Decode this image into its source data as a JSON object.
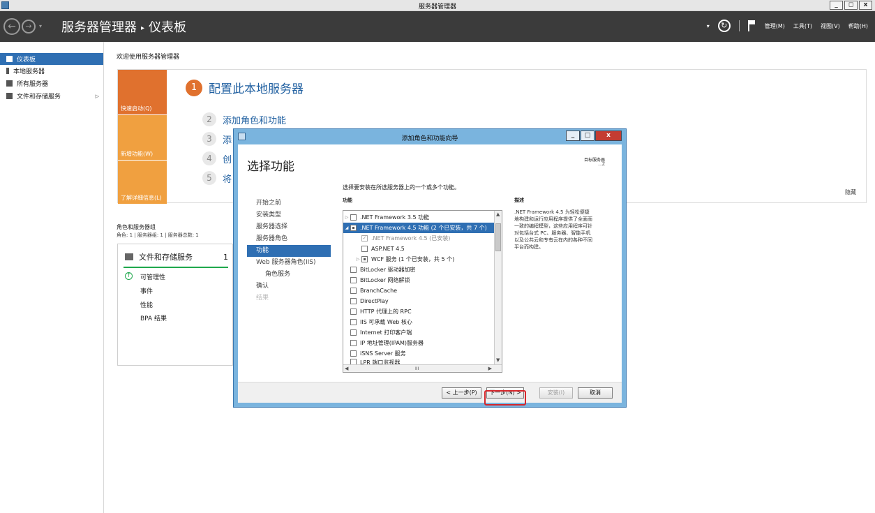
{
  "window": {
    "title": "服务器管理器",
    "controls": [
      "_",
      "◻",
      "x"
    ]
  },
  "header": {
    "crumb_app": "服务器管理器",
    "crumb_sep": "▸",
    "crumb_page": "仪表板",
    "menus": [
      "管理(M)",
      "工具(T)",
      "视图(V)",
      "帮助(H)"
    ]
  },
  "sidebar": {
    "items": [
      {
        "label": "仪表板",
        "icon": "dashboard-icon",
        "active": true
      },
      {
        "label": "本地服务器",
        "icon": "server-icon"
      },
      {
        "label": "所有服务器",
        "icon": "servers-icon"
      },
      {
        "label": "文件和存储服务",
        "icon": "storage-icon",
        "has_children": true
      }
    ]
  },
  "main": {
    "welcome": "欢迎使用服务器管理器",
    "tiles": [
      "快速启动(Q)",
      "新增功能(W)",
      "了解详细信息(L)"
    ],
    "steps": [
      {
        "num": "1",
        "label": "配置此本地服务器"
      },
      {
        "num": "2",
        "label": "添加角色和功能"
      },
      {
        "num": "3",
        "label": "添"
      },
      {
        "num": "4",
        "label": "创"
      },
      {
        "num": "5",
        "label": "将"
      }
    ],
    "hide": "隐藏",
    "roles_title": "角色和服务器组",
    "roles_sub": "角色: 1 | 服务器组: 1 | 服务器总数: 1",
    "role_card": {
      "title": "文件和存储服务",
      "count": "1",
      "rows": [
        "可管理性",
        "事件",
        "性能",
        "BPA 结果"
      ]
    }
  },
  "dialog": {
    "title": "添加角色和功能向导",
    "heading": "选择功能",
    "dest_label": "目标服务器",
    "dest_value": "...Z",
    "nav": [
      {
        "label": "开始之前"
      },
      {
        "label": "安装类型"
      },
      {
        "label": "服务器选择"
      },
      {
        "label": "服务器角色"
      },
      {
        "label": "功能",
        "active": true
      },
      {
        "label": "Web 服务器角色(IIS)"
      },
      {
        "label": "角色服务",
        "sub": true
      },
      {
        "label": "确认"
      },
      {
        "label": "结果",
        "disabled": true
      }
    ],
    "instruction": "选择要安装在所选服务器上的一个或多个功能。",
    "features_header": "功能",
    "description_header": "描述",
    "description": ".NET Framework 4.5 为轻松便捷地构建和运行应用程序提供了全面而一致的编程模型，这些应用程序可针对包括台式 PC、服务器、智能手机以及公共云和专有云在内的各种不同平台而构建。",
    "features": [
      {
        "label": ".NET Framework 3.5 功能",
        "expander": "▷",
        "check": "",
        "indent": 0
      },
      {
        "label": ".NET Framework 4.5 功能 (2 个已安装，共 7 个)",
        "expander": "◢",
        "check": "partial",
        "indent": 0,
        "selected": true
      },
      {
        "label": ".NET Framework 4.5 (已安装)",
        "expander": "",
        "check": "✓",
        "indent": 1,
        "dim": true
      },
      {
        "label": "ASP.NET 4.5",
        "expander": "",
        "check": "",
        "indent": 1
      },
      {
        "label": "WCF 服务 (1 个已安装，共 5 个)",
        "expander": "▷",
        "check": "partial",
        "indent": 1
      },
      {
        "label": "BitLocker 驱动器加密",
        "expander": "",
        "check": "",
        "indent": 0
      },
      {
        "label": "BitLocker 网络解锁",
        "expander": "",
        "check": "",
        "indent": 0
      },
      {
        "label": "BranchCache",
        "expander": "",
        "check": "",
        "indent": 0
      },
      {
        "label": "DirectPlay",
        "expander": "",
        "check": "",
        "indent": 0
      },
      {
        "label": "HTTP 代理上的 RPC",
        "expander": "",
        "check": "",
        "indent": 0
      },
      {
        "label": "IIS 可承载 Web 核心",
        "expander": "",
        "check": "",
        "indent": 0
      },
      {
        "label": "Internet 打印客户端",
        "expander": "",
        "check": "",
        "indent": 0
      },
      {
        "label": "IP 地址管理(IPAM)服务器",
        "expander": "",
        "check": "",
        "indent": 0
      },
      {
        "label": "iSNS Server 服务",
        "expander": "",
        "check": "",
        "indent": 0
      },
      {
        "label": "LPR 端口监视器",
        "expander": "",
        "check": "",
        "indent": 0
      }
    ],
    "scroll_mid": "III",
    "buttons": {
      "prev": "< 上一步(P)",
      "next": "下一步(N) >",
      "install": "安装(I)",
      "cancel": "取消"
    }
  }
}
